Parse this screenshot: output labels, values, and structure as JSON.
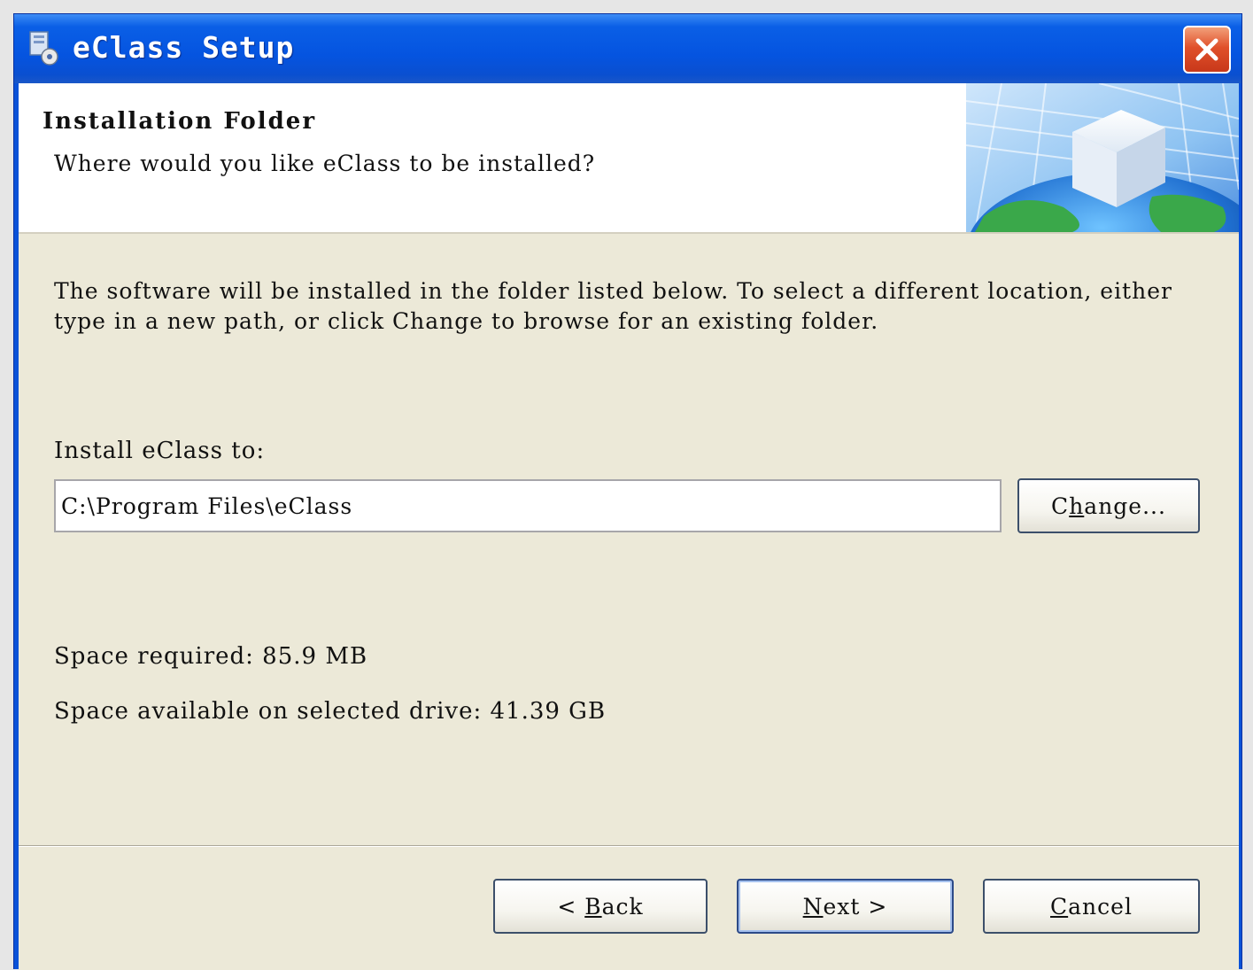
{
  "window": {
    "title": "eClass Setup"
  },
  "header": {
    "title": "Installation Folder",
    "subtitle": "Where would you like eClass to be installed?"
  },
  "body": {
    "description": "The software will be installed in the folder listed below. To select a different location, either type in a new path, or click Change to browse for an existing folder."
  },
  "install": {
    "label": "Install eClass to:",
    "path": "C:\\Program Files\\eClass",
    "change_button": {
      "pre": "C",
      "accel": "h",
      "post": "ange..."
    }
  },
  "space": {
    "required": "Space required: 85.9 MB",
    "available": "Space available on selected drive: 41.39 GB"
  },
  "buttons": {
    "back": {
      "pre": "< ",
      "accel": "B",
      "post": "ack"
    },
    "next": {
      "pre": "",
      "accel": "N",
      "post": "ext >"
    },
    "cancel": {
      "pre": "",
      "accel": "C",
      "post": "ancel"
    }
  }
}
